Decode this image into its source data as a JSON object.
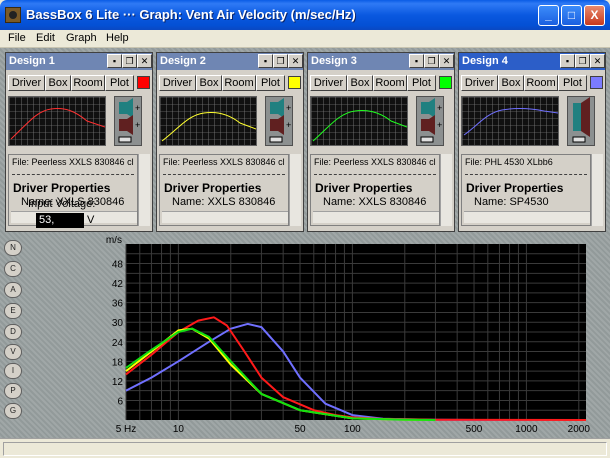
{
  "window": {
    "title": "BassBox 6 Lite ··· Graph: Vent Air Velocity (m/sec/Hz)",
    "controls": [
      "_",
      "□",
      "X"
    ]
  },
  "menubar": [
    "File",
    "Edit",
    "Graph",
    "Help"
  ],
  "designs": [
    {
      "title": "Design 1",
      "tabs": [
        "Driver",
        "Box",
        "Room",
        "Plot"
      ],
      "color": "#ff0000",
      "file": "File: Peerless XXLS 830846 cl",
      "props": "Driver Properties",
      "name": "Name: XXLS 830846",
      "active": false
    },
    {
      "title": "Design 2",
      "tabs": [
        "Driver",
        "Box",
        "Room",
        "Plot"
      ],
      "color": "#ffff00",
      "file": "File: Peerless XXLS 830846 cl",
      "props": "Driver Properties",
      "name": "Name: XXLS 830846",
      "active": false
    },
    {
      "title": "Design 3",
      "tabs": [
        "Driver",
        "Box",
        "Room",
        "Plot"
      ],
      "color": "#00ff00",
      "file": "File: Peerless XXLS 830846 cl",
      "props": "Driver Properties",
      "name": "Name: XXLS 830846",
      "active": false
    },
    {
      "title": "Design 4",
      "tabs": [
        "Driver",
        "Box",
        "Room",
        "Plot"
      ],
      "color": "#7b7bff",
      "file": "File: PHL 4530 XLbb6",
      "props": "Driver Properties",
      "name": "Name: SP4530",
      "active": true
    }
  ],
  "panel_buttons": [
    "N",
    "C",
    "A",
    "E",
    "D",
    "V",
    "I",
    "P",
    "G"
  ],
  "input_voltage": {
    "label": "Input Voltage:",
    "value": "53,",
    "unit": "V"
  },
  "chart_data": {
    "type": "line",
    "ylabel": "m/s",
    "xscale": "log",
    "grid": true,
    "background": "#000000",
    "yticks": [
      6,
      12,
      18,
      24,
      30,
      36,
      42,
      48
    ],
    "ylim": [
      0,
      54
    ],
    "xtick_labels": [
      "5 Hz",
      "10",
      "50",
      "100",
      "500",
      "1000",
      "2000"
    ],
    "xtick_values": [
      5,
      10,
      50,
      100,
      500,
      1000,
      2000
    ],
    "xlim": [
      5,
      2200
    ],
    "series": [
      {
        "color": "#7070ff",
        "x": [
          5,
          7,
          10,
          15,
          20,
          25,
          30,
          40,
          50,
          70,
          100,
          150,
          200,
          300,
          500,
          1000,
          2200
        ],
        "y": [
          9,
          13,
          18,
          24,
          28,
          29.5,
          28.5,
          21,
          13,
          5,
          1.5,
          0.4,
          0.2,
          0.1,
          0,
          0,
          0
        ]
      },
      {
        "color": "#ff1a1a",
        "x": [
          5,
          7,
          10,
          13,
          16,
          19,
          24,
          30,
          40,
          60,
          80,
          100,
          150,
          300,
          2200
        ],
        "y": [
          14,
          20,
          27,
          30.5,
          31.5,
          29,
          21,
          13,
          7,
          3,
          1.5,
          0.8,
          0.3,
          0.1,
          0
        ]
      },
      {
        "color": "#ffff00",
        "x": [
          5,
          7,
          10,
          12,
          15,
          20,
          30,
          50,
          100,
          200,
          300
        ],
        "y": [
          15,
          21,
          27.5,
          28,
          25,
          17,
          8,
          3,
          0.5,
          0.1,
          0
        ]
      },
      {
        "color": "#10e010",
        "x": [
          5,
          7,
          10,
          12,
          15,
          20,
          30,
          50,
          100,
          200,
          300
        ],
        "y": [
          16,
          21.5,
          27,
          28,
          25.5,
          18,
          8,
          3,
          0.5,
          0.1,
          0
        ]
      }
    ]
  }
}
